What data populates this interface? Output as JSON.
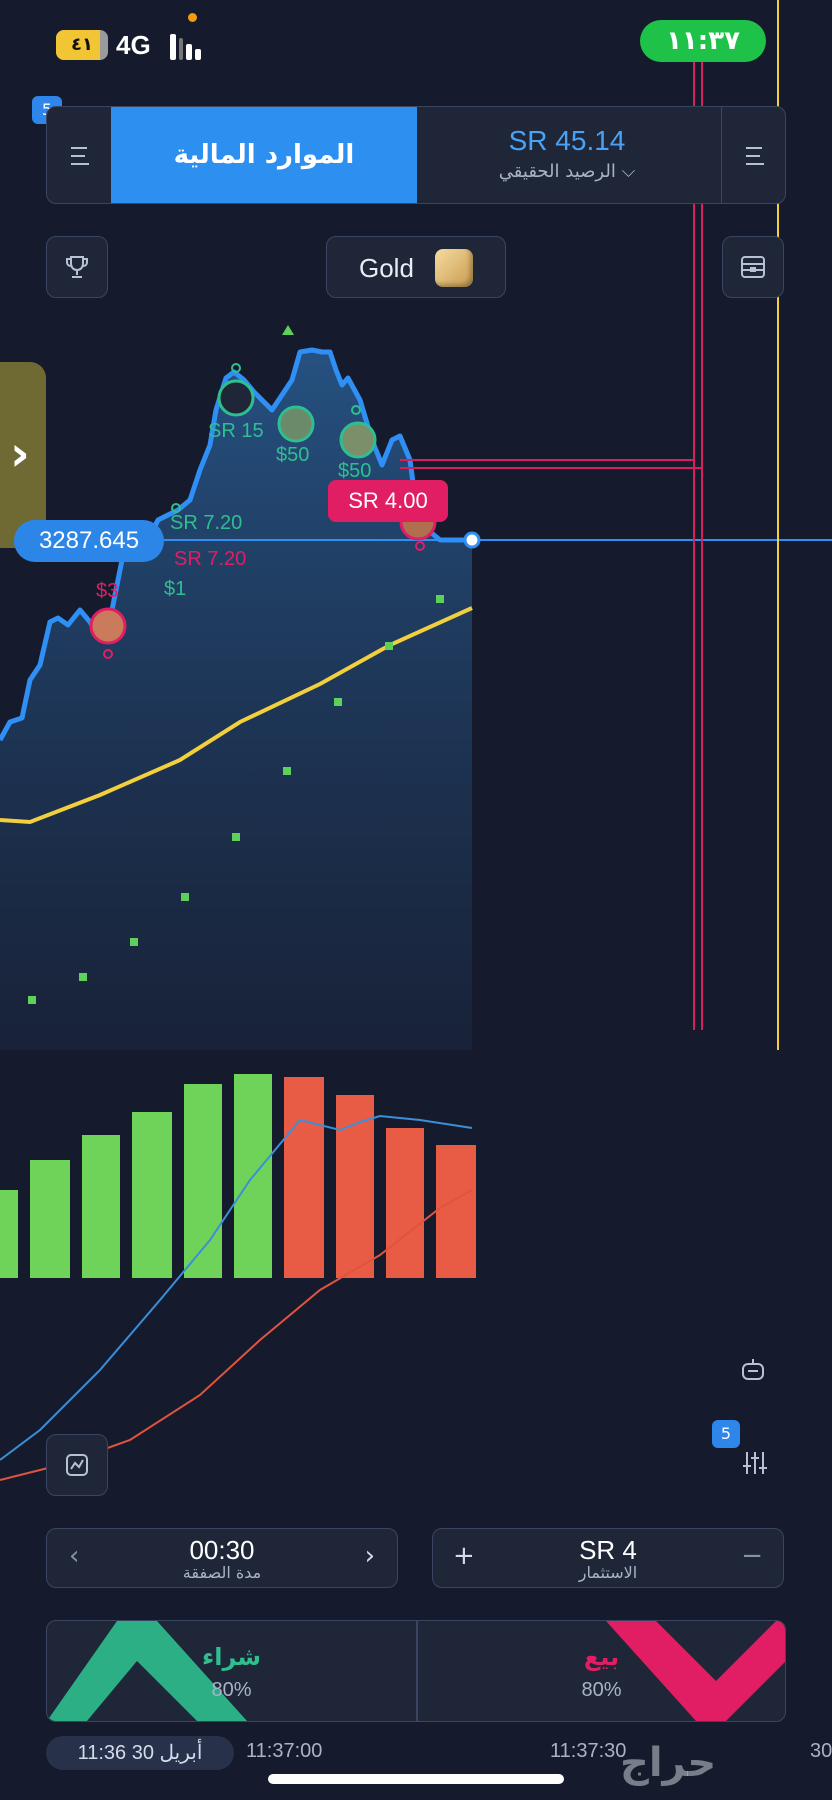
{
  "status": {
    "battery": "٤١",
    "network": "4G",
    "time": "١١:٣٧"
  },
  "header": {
    "badge": "5",
    "assets_label": "الموارد المالية",
    "balance_amount": "SR 45.14",
    "balance_label": "الرصيد الحقيقي ⌵"
  },
  "asset": {
    "name": "Gold"
  },
  "chart": {
    "current_price": "3287.645",
    "trade_bubble": "SR 4.00",
    "labels": {
      "sr15": "SR 15",
      "d50a": "$50",
      "d50b": "$50",
      "sr720a": "SR 7.20",
      "sr720b": "SR 7.20",
      "d1": "$1",
      "d3": "$3"
    }
  },
  "indicators": {
    "badge": "5"
  },
  "controls": {
    "duration_value": "00:30",
    "duration_label": "مدة الصفقة",
    "investment_value": "SR 4",
    "investment_label": "الاستثمار"
  },
  "trade": {
    "buy_label": "شراء",
    "buy_pct": "80%",
    "sell_label": "بيع",
    "sell_pct": "80%"
  },
  "timeline": {
    "now": "11:36 30 أبريل",
    "t1": "11:37:00",
    "t2": "11:37:30",
    "t3": "30"
  },
  "watermark": "حراج",
  "colors": {
    "accent": "#2d8ff0",
    "buy": "#2fbf8f",
    "sell": "#e11e63",
    "up_bar": "#6fd35a",
    "down_bar": "#e85c45"
  }
}
